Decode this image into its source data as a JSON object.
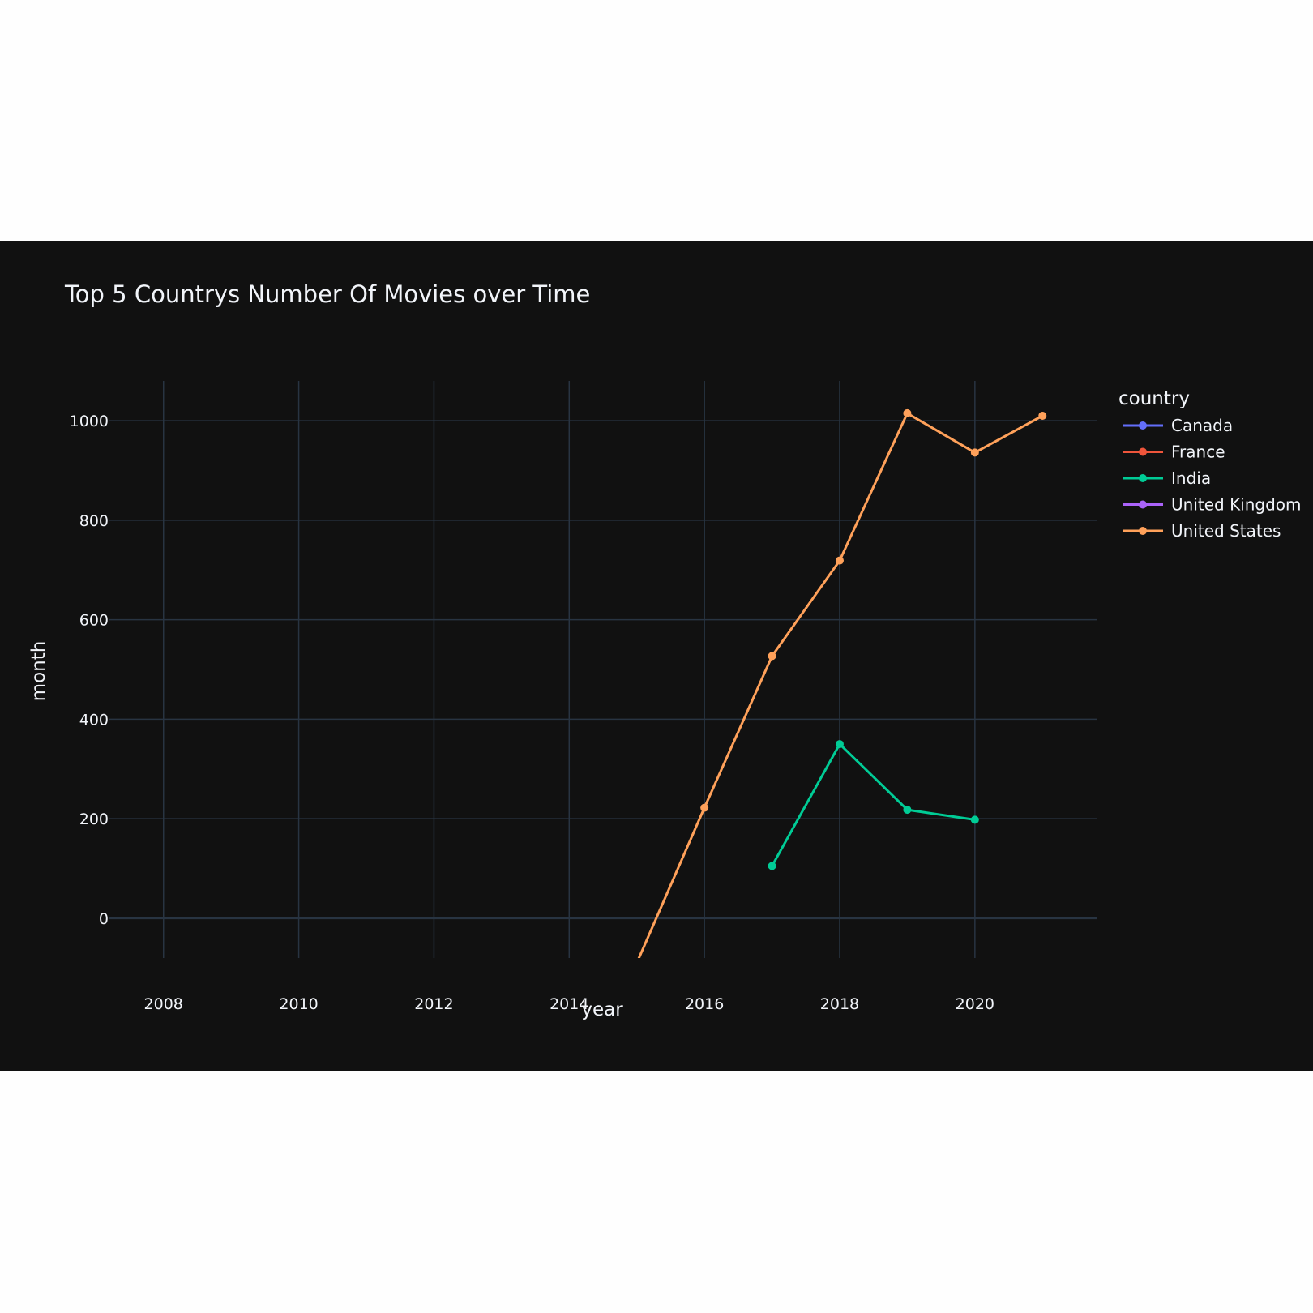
{
  "chart_data": {
    "type": "line",
    "title": "Top 5 Countrys Number Of Movies over Time",
    "xlabel": "year",
    "ylabel": "month",
    "xlim": [
      2007.2,
      2021.8
    ],
    "ylim": [
      -80,
      1080
    ],
    "x_ticks": [
      2008,
      2010,
      2012,
      2014,
      2016,
      2018,
      2020
    ],
    "y_ticks": [
      0,
      200,
      400,
      600,
      800,
      1000
    ],
    "grid": true,
    "legend_title": "country",
    "legend_position": "right",
    "background": "#111111",
    "grid_color": "#283442",
    "series": [
      {
        "name": "Canada",
        "color": "#636efa",
        "x": [],
        "y": []
      },
      {
        "name": "France",
        "color": "#EF553B",
        "x": [],
        "y": []
      },
      {
        "name": "India",
        "color": "#00cc96",
        "x": [
          2017,
          2018,
          2019,
          2020
        ],
        "y": [
          105,
          350,
          218,
          198
        ]
      },
      {
        "name": "United Kingdom",
        "color": "#ab63fa",
        "x": [],
        "y": []
      },
      {
        "name": "United States",
        "color": "#FFA15A",
        "x": [
          2015,
          2016,
          2017,
          2018,
          2019,
          2020,
          2021
        ],
        "y": [
          -90,
          222,
          527,
          719,
          1015,
          936,
          1010
        ]
      }
    ]
  }
}
